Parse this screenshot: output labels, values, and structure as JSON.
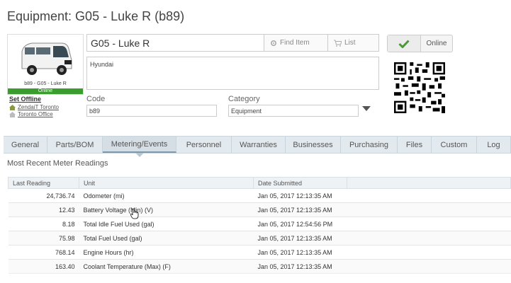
{
  "page": {
    "title": "Equipment: G05 - Luke R (b89)"
  },
  "asset": {
    "caption": "b89 - G05 - Luke R",
    "status": "Online",
    "set_offline_label": "Set Offline",
    "locations": [
      "ZendaiT Toronto",
      "Toronto Office"
    ]
  },
  "form": {
    "name_value": "G05 - Luke R",
    "find_item_label": "Find Item",
    "list_label": "List",
    "description": "Hyundai",
    "code_label": "Code",
    "code_value": "b89",
    "category_label": "Category",
    "category_value": "Equipment",
    "online_label": "Online"
  },
  "colors": {
    "online_green": "#3a9d2e",
    "check_green": "#4a9a35"
  },
  "tabs": [
    {
      "label": "General",
      "active": false
    },
    {
      "label": "Parts/BOM",
      "active": false
    },
    {
      "label": "Metering/Events",
      "active": true
    },
    {
      "label": "Personnel",
      "active": false
    },
    {
      "label": "Warranties",
      "active": false
    },
    {
      "label": "Businesses",
      "active": false
    },
    {
      "label": "Purchasing",
      "active": false
    },
    {
      "label": "Files",
      "active": false
    },
    {
      "label": "Custom",
      "active": false
    },
    {
      "label": "Log",
      "active": false
    }
  ],
  "readings": {
    "heading": "Most Recent Meter Readings",
    "columns": [
      "Last Reading",
      "Unit",
      "Date Submitted"
    ],
    "rows": [
      {
        "reading": "24,736.74",
        "unit": "Odometer (mi)",
        "date": "Jan 05, 2017 12:13:35 AM"
      },
      {
        "reading": "12.43",
        "unit": "Battery Voltage (Min) (V)",
        "date": "Jan 05, 2017 12:13:35 AM"
      },
      {
        "reading": "8.18",
        "unit": "Total Idle Fuel Used (gal)",
        "date": "Jan 05, 2017 12:54:56 PM"
      },
      {
        "reading": "75.98",
        "unit": "Total Fuel Used (gal)",
        "date": "Jan 05, 2017 12:13:35 AM"
      },
      {
        "reading": "768.14",
        "unit": "Engine Hours (hr)",
        "date": "Jan 05, 2017 12:13:35 AM"
      },
      {
        "reading": "163.40",
        "unit": "Coolant Temperature (Max) (F)",
        "date": "Jan 05, 2017 12:13:35 AM"
      }
    ]
  }
}
